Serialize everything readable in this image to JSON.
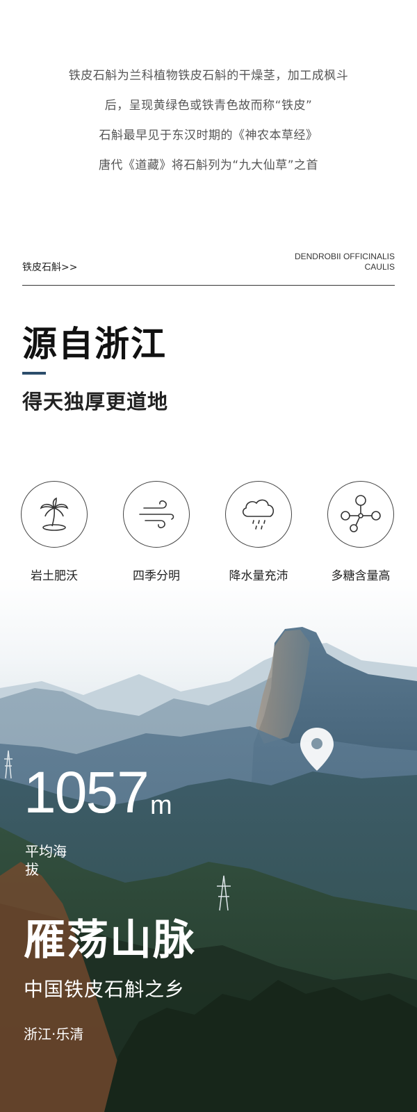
{
  "intro": {
    "lines": [
      "铁皮石斛为兰科植物铁皮石斛的干燥茎，加工成枫斗",
      "后，呈现黄绿色或铁青色故而称“铁皮”",
      "石斛最早见于东汉时期的《神农本草经》",
      "唐代《道藏》将石斛列为“九大仙草”之首"
    ]
  },
  "section": {
    "left_label": "铁皮石斛>>",
    "right_label_line1": "DENDROBII OFFICINALIS",
    "right_label_line2": "CAULIS",
    "accent_color": "#2c4d6b"
  },
  "heading": {
    "title": "源自浙江",
    "subtitle": "得天独厚更道地"
  },
  "features": [
    {
      "icon": "palm-tree-icon",
      "label": "岩土肥沃"
    },
    {
      "icon": "wind-icon",
      "label": "四季分明"
    },
    {
      "icon": "rain-cloud-icon",
      "label": "降水量充沛"
    },
    {
      "icon": "molecule-icon",
      "label": "多糖含量高"
    }
  ],
  "scene": {
    "altitude_value": "1057",
    "altitude_unit": "m",
    "altitude_label": "平均海拔",
    "mountain_name": "雁荡山脉",
    "mountain_subtitle": "中国铁皮石斛之乡",
    "location": "浙江·乐清",
    "pin_icon": "location-pin-icon"
  }
}
